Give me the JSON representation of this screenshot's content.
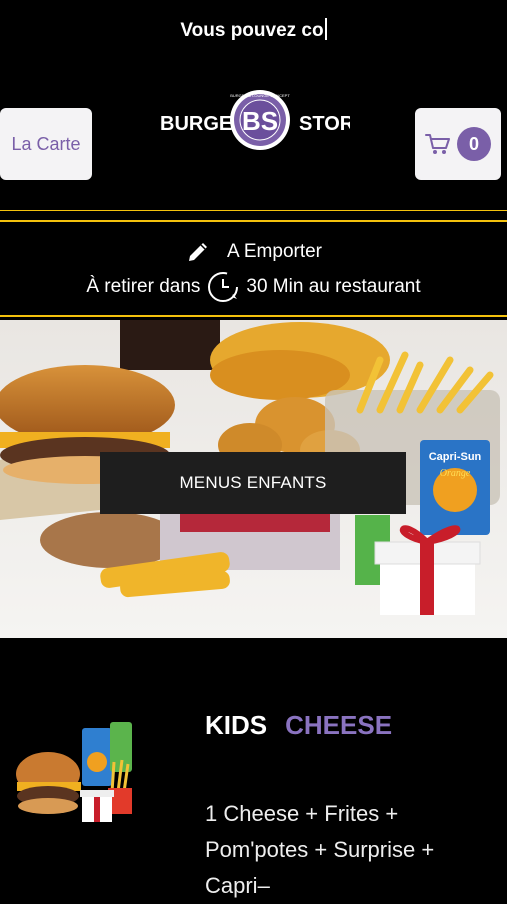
{
  "header": {
    "marquee_text": "Vous pouvez co",
    "menu_label": "La Carte",
    "logo": {
      "left_word": "BURGER",
      "monogram": "BS",
      "right_word": "STORE",
      "ring_text": "BURGER & LOUNGE CONCEPT"
    },
    "cart_count": "0"
  },
  "order": {
    "mode_label": "A Emporter",
    "pickup_prefix": "À retirer dans",
    "pickup_suffix": "30 Min au restaurant"
  },
  "banner": {
    "category_label": "MENUS ENFANTS",
    "drink_brand": "Capri-Sun",
    "drink_flavor": "Orange"
  },
  "product": {
    "title_first": "KIDS",
    "title_second": "CHEESE",
    "description": "1 Cheese + Frites + Pom'potes + Surprise + Capri–"
  },
  "colors": {
    "accent_purple": "#7a5fa8",
    "border_yellow": "#f4c20d",
    "background": "#000000"
  },
  "icons": [
    "cart-icon",
    "pencil-icon",
    "clock-icon"
  ]
}
